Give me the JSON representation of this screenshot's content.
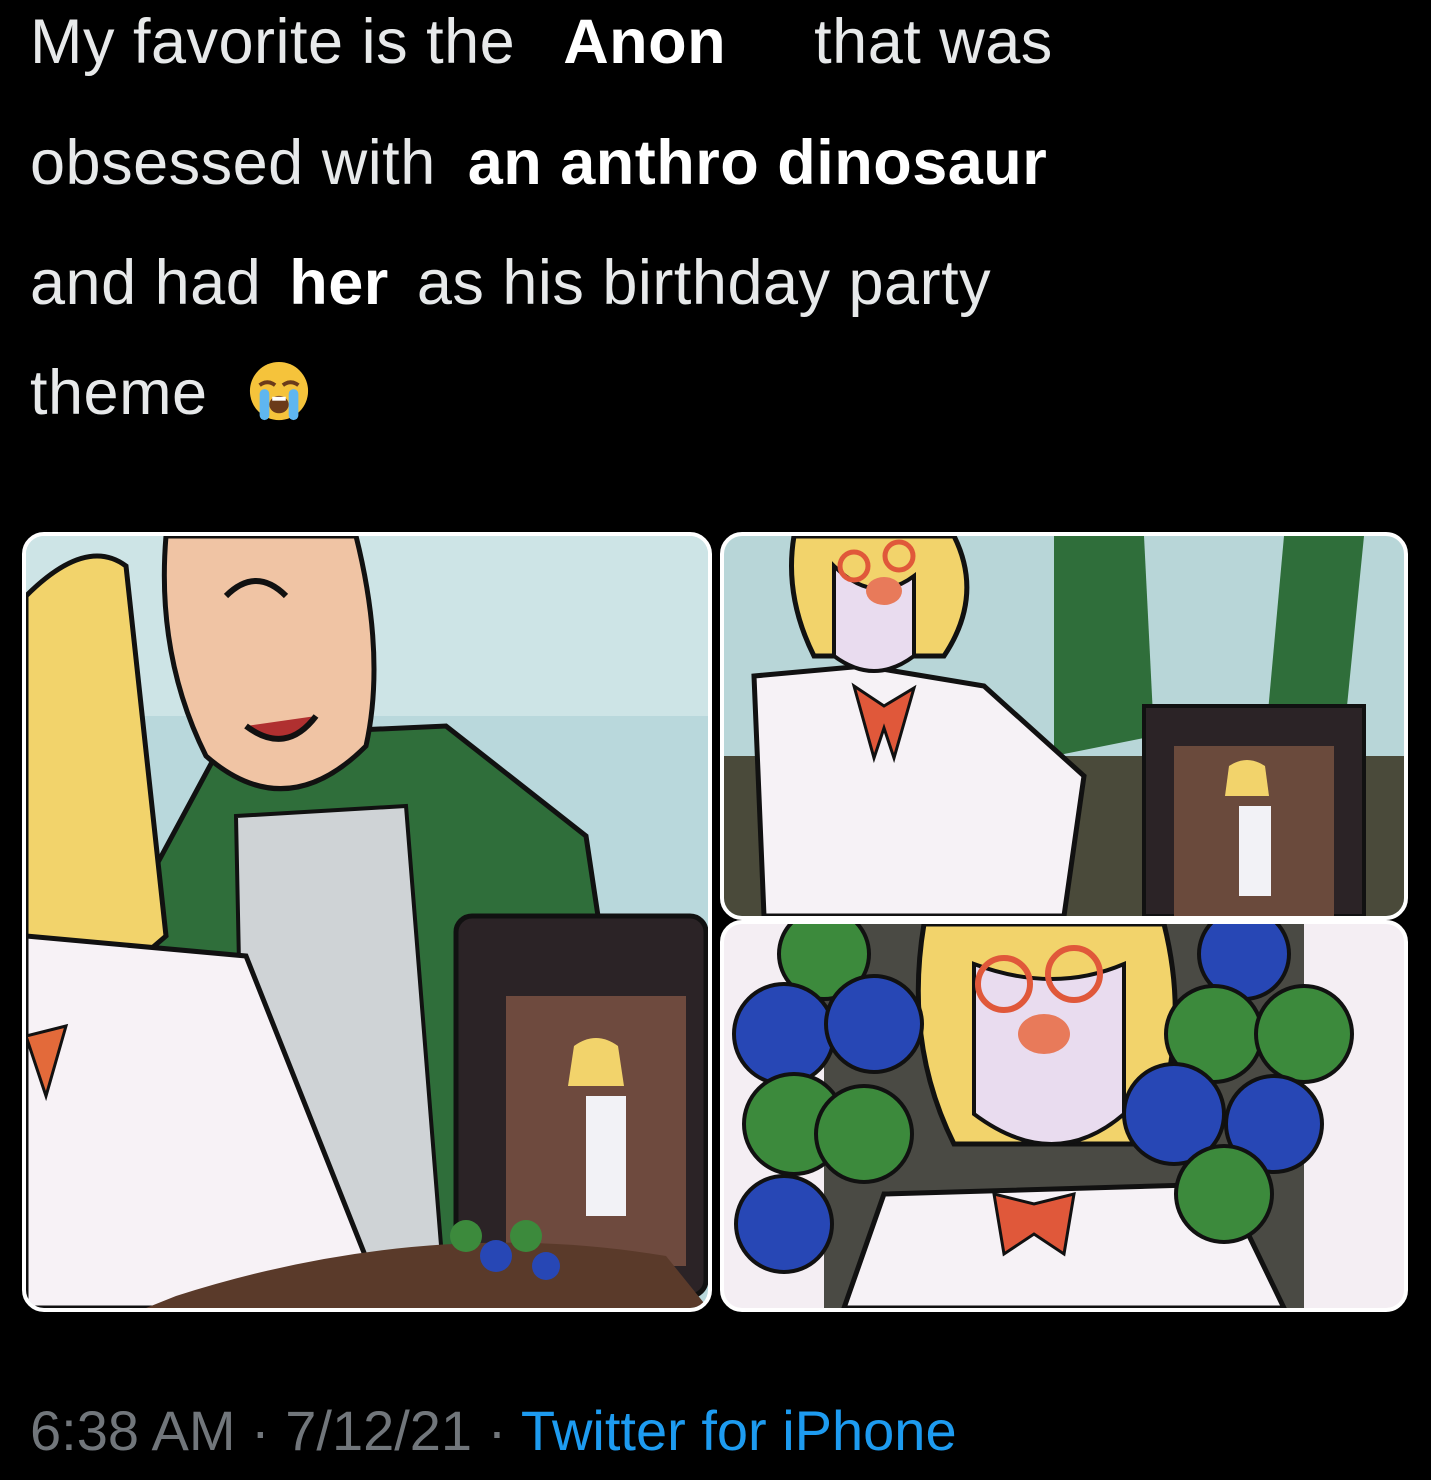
{
  "tweet": {
    "line1": {
      "a": "My favorite is the",
      "b": "Anon",
      "c": "that was"
    },
    "line2": {
      "a": "obsessed with",
      "b": "an anthro dinosaur"
    },
    "line3": {
      "a": "and had",
      "b": "her",
      "c": "as his birthday party"
    },
    "line4": {
      "a": "theme",
      "emoji": "loudly-crying-face-icon"
    }
  },
  "meta": {
    "time": "6:38 AM",
    "sep1": " · ",
    "date": "7/12/21",
    "sep2": " · ",
    "source": "Twitter for iPhone"
  },
  "colors": {
    "background": "#000000",
    "text": "#e7e9ea",
    "muted": "#71767b",
    "link": "#1d9bf0"
  },
  "images": {
    "comic": [
      "comic-panel-man-with-photo",
      "comic-panel-girl-with-framed-photo",
      "comic-panel-girl-with-balloons"
    ]
  }
}
